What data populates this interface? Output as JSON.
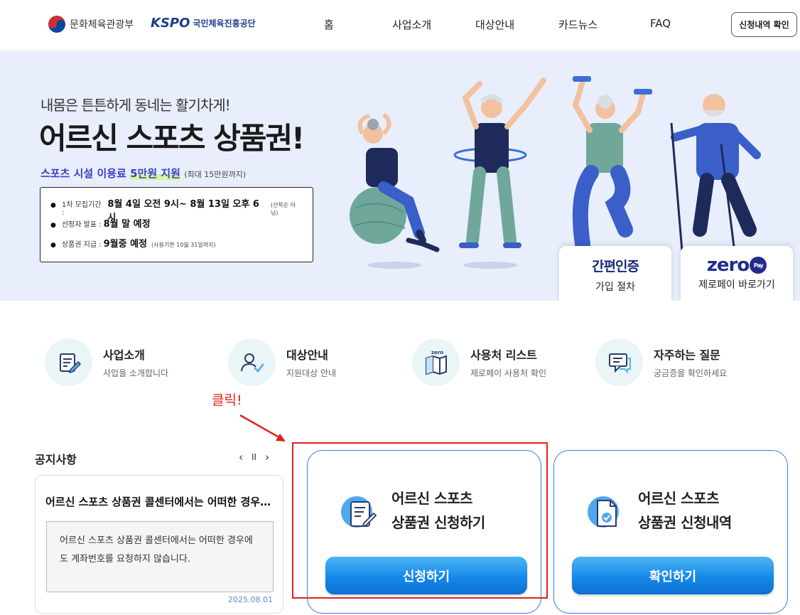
{
  "header": {
    "ministry_name": "문화체육관광부",
    "kspo_mark": "KSPO",
    "kspo_name": "국민체육진흥공단",
    "nav": [
      "홈",
      "사업소개",
      "대상안내",
      "카드뉴스",
      "FAQ"
    ],
    "history_button": "신청내역 확인"
  },
  "hero": {
    "subtitle": "내몸은 튼튼하게 동네는 활기차게!",
    "title": "어르신 스포츠 상품권!",
    "support_prefix": "스포츠 시설 이용료 ",
    "support_highlight": "5만원 지원",
    "support_note": "(최대 15만원까지)",
    "info": [
      {
        "label": "1차 모집기간 :",
        "value": "8월 4일 오전 9시~ 8월 13일 오후 6시",
        "note": "(선착순 아님)"
      },
      {
        "label": "선정자 발표 :",
        "value": "8월 말 예정",
        "note": ""
      },
      {
        "label": "상품권 지급 :",
        "value": "9월중 예정",
        "note": "(사용기한 10월 31일까지)"
      }
    ],
    "quick_links": [
      {
        "title": "간편인증",
        "label": "가입 절차"
      },
      {
        "logo": "zero",
        "logo_badge": "Pay",
        "label": "제로페이 바로가기"
      }
    ]
  },
  "menu": [
    {
      "title": "사업소개",
      "desc": "사업을 소개합니다",
      "icon": "document-pen-icon"
    },
    {
      "title": "대상안내",
      "desc": "지원대상 안내",
      "icon": "user-check-icon"
    },
    {
      "title": "사용처 리스트",
      "desc": "제로페이 사용처 확인",
      "icon": "map-icon",
      "icon_label": "zero"
    },
    {
      "title": "자주하는 질문",
      "desc": "궁금증을 확인하세요",
      "icon": "chat-icon"
    }
  ],
  "annotation": {
    "text": "클릭!",
    "color": "#e0201b"
  },
  "notice": {
    "title": "공지사항",
    "prev": "‹",
    "pause": "II",
    "next": "›",
    "headline": "어르신 스포츠 상품권 콜센터에서는 어떠한 경우에도 계좌번호를 요청하지 않습니다.",
    "body": "어르신 스포츠 상품권 콜센터에서는 어떠한 경우에도 계좌번호를 요청하지 않습니다.",
    "date": "2025.08.01"
  },
  "actions": [
    {
      "line1": "어르신 스포츠",
      "line2": "상품권 신청하기",
      "button": "신청하기"
    },
    {
      "line1": "어르신 스포츠",
      "line2": "상품권 신청내역",
      "button": "확인하기"
    }
  ],
  "colors": {
    "accent": "#1689e8",
    "brand_navy": "#1c2a7a",
    "hero_bg": "#e8eefb"
  }
}
